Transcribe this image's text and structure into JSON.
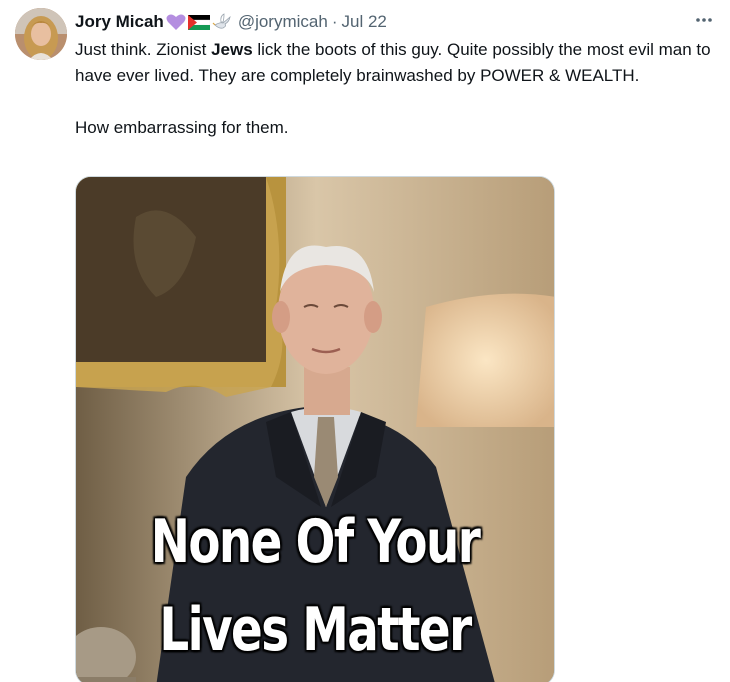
{
  "tweet": {
    "author_name": "Jory Micah",
    "author_emojis": [
      "purple-heart-icon",
      "palestine-flag-icon",
      "dove-icon"
    ],
    "handle": "@jorymicah",
    "separator": "·",
    "date": "Jul 22",
    "text_part1": "Just think. Zionist ",
    "text_bold": "Jews",
    "text_part2": " lick the boots of this guy. Quite possibly the most evil man to have ever lived. They are completely brainwashed by POWER & WEALTH.",
    "text_line2": "How embarrassing for them.",
    "image_caption_line1": "None Of Your",
    "image_caption_line2": "Lives Matter"
  },
  "colors": {
    "text": "#0f1419",
    "secondary": "#536471",
    "border": "#cfd9de",
    "heart": "#b48ee0"
  }
}
